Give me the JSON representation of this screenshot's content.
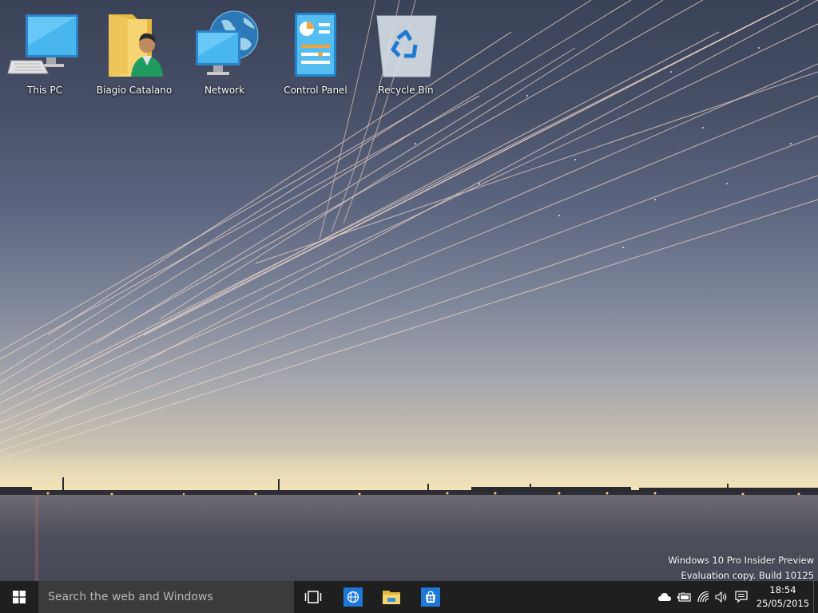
{
  "desktop": {
    "icons": [
      {
        "label": "This PC",
        "icon": "computer-icon"
      },
      {
        "label": "Biagio Catalano",
        "icon": "user-folder-icon"
      },
      {
        "label": "Network",
        "icon": "network-icon"
      },
      {
        "label": "Control Panel",
        "icon": "control-panel-icon"
      },
      {
        "label": "Recycle Bin",
        "icon": "recycle-bin-icon"
      }
    ],
    "watermark": {
      "line1": "Windows 10 Pro Insider Preview",
      "line2": "Evaluation copy. Build 10125"
    }
  },
  "taskbar": {
    "start_icon": "windows-logo-icon",
    "search_placeholder": "Search the web and Windows",
    "pinned": [
      {
        "icon": "task-view-icon"
      },
      {
        "icon": "browser-globe-icon"
      },
      {
        "icon": "file-explorer-icon"
      },
      {
        "icon": "store-icon"
      }
    ],
    "tray": [
      {
        "icon": "onedrive-cloud-icon"
      },
      {
        "icon": "battery-icon"
      },
      {
        "icon": "wifi-icon"
      },
      {
        "icon": "volume-icon"
      },
      {
        "icon": "action-center-icon"
      }
    ],
    "clock": {
      "time": "18:54",
      "date": "25/05/2015"
    }
  },
  "colors": {
    "taskbar_bg": "#1f1f1f",
    "search_bg": "#3b3b3b",
    "accent": "#1e78d8"
  }
}
